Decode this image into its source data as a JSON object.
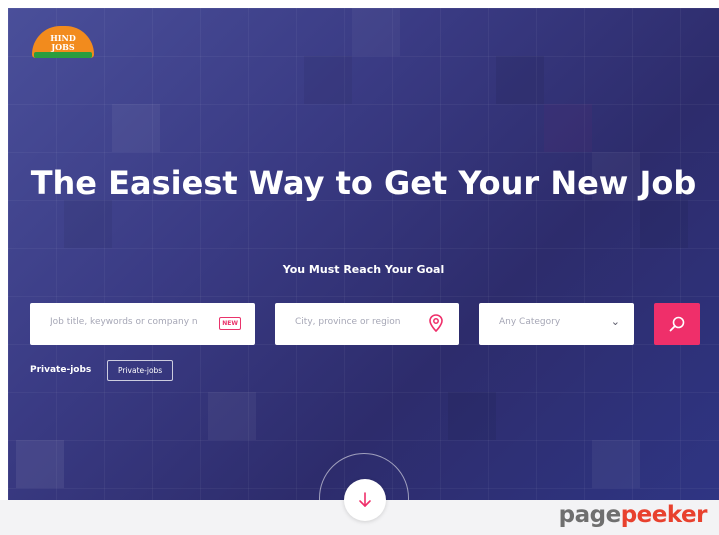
{
  "brand": {
    "logo_text_line1": "HIND",
    "logo_text_line2": "JOBS",
    "colors": {
      "sun": "#f28b1d",
      "leaf": "#2a9d3f"
    }
  },
  "hero": {
    "title": "The Easiest Way to Get Your New Job",
    "subtitle": "You Must Reach Your Goal"
  },
  "search": {
    "keyword_placeholder": "Job title, keywords or company n",
    "keyword_badge": "NEW",
    "location_placeholder": "City, province or region",
    "category_selected": "Any Category",
    "search_icon": "search-icon",
    "location_icon": "map-pin-icon"
  },
  "tags": {
    "label": "Private-jobs",
    "items": [
      "Private-jobs"
    ]
  },
  "scroll": {
    "icon": "arrow-down-icon"
  },
  "watermark": {
    "part1": "page",
    "part2": "peeker"
  },
  "colors": {
    "accent": "#ef2f6a",
    "hero_dark": "#2d2c6c",
    "hero_light": "#4a4f9a"
  }
}
